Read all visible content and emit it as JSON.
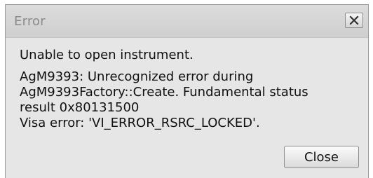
{
  "dialog": {
    "title": "Error",
    "close_icon": "close-x-icon",
    "message": {
      "headline": "Unable to open instrument.",
      "detail_lines": [
        "AgM9393: Unrecognized error during",
        "AgM9393Factory::Create. Fundamental status",
        "result 0x80131500",
        "Visa error: 'VI_ERROR_RSRC_LOCKED'."
      ]
    },
    "buttons": {
      "close_label": "Close"
    }
  }
}
